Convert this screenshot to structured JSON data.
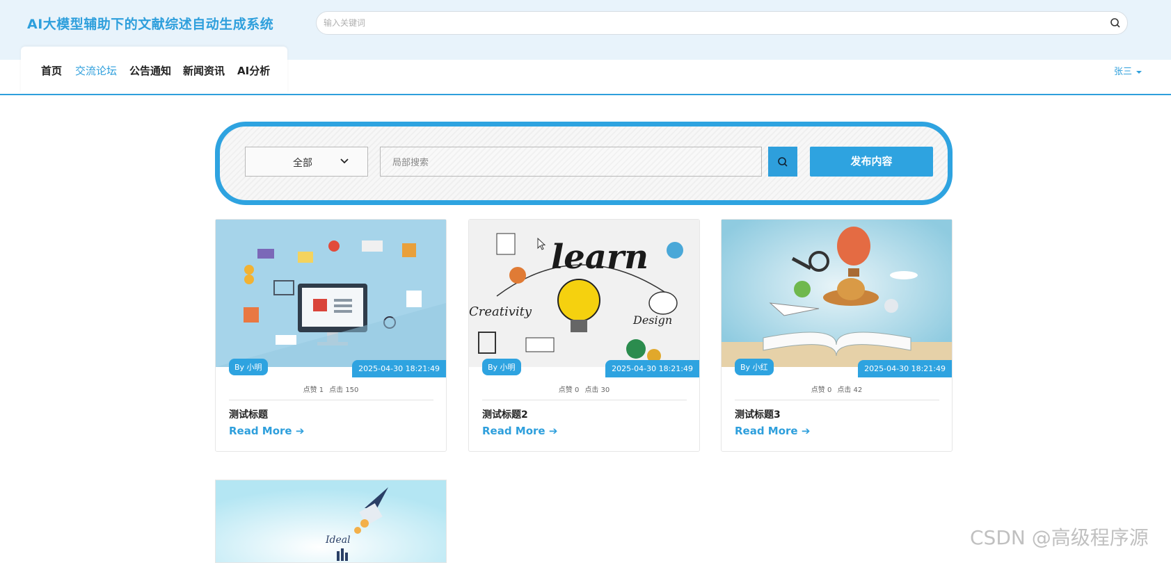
{
  "header": {
    "site_title": "AI大模型辅助下的文献综述自动生成系统",
    "search_placeholder": "输入关键词"
  },
  "nav": {
    "items": [
      {
        "label": "首页",
        "active": false
      },
      {
        "label": "交流论坛",
        "active": true
      },
      {
        "label": "公告通知",
        "active": false
      },
      {
        "label": "新闻资讯",
        "active": false
      },
      {
        "label": "AI分析",
        "active": false
      }
    ],
    "user": "张三"
  },
  "filter": {
    "category": "全部",
    "search_placeholder": "局部搜索",
    "publish_label": "发布内容"
  },
  "posts": [
    {
      "author": "By 小明",
      "date": "2025-04-30 18:21:49",
      "likes": "点赞 1",
      "clicks": "点击 150",
      "title": "测试标题",
      "read_more": "Read More ➔",
      "image": "ecommerce-illustration"
    },
    {
      "author": "By 小明",
      "date": "2025-04-30 18:21:49",
      "likes": "点赞 0",
      "clicks": "点击 30",
      "title": "测试标题2",
      "read_more": "Read More ➔",
      "image": "learn-lightbulb-illustration"
    },
    {
      "author": "By 小红",
      "date": "2025-04-30 18:21:49",
      "likes": "点赞 0",
      "clicks": "点击 42",
      "title": "测试标题3",
      "read_more": "Read More ➔",
      "image": "open-book-travel-illustration"
    },
    {
      "image": "rocket-illustration"
    }
  ],
  "watermark": "CSDN @高级程序源",
  "colors": {
    "accent": "#2e9fdc",
    "header_bg": "#e8f3fb"
  }
}
